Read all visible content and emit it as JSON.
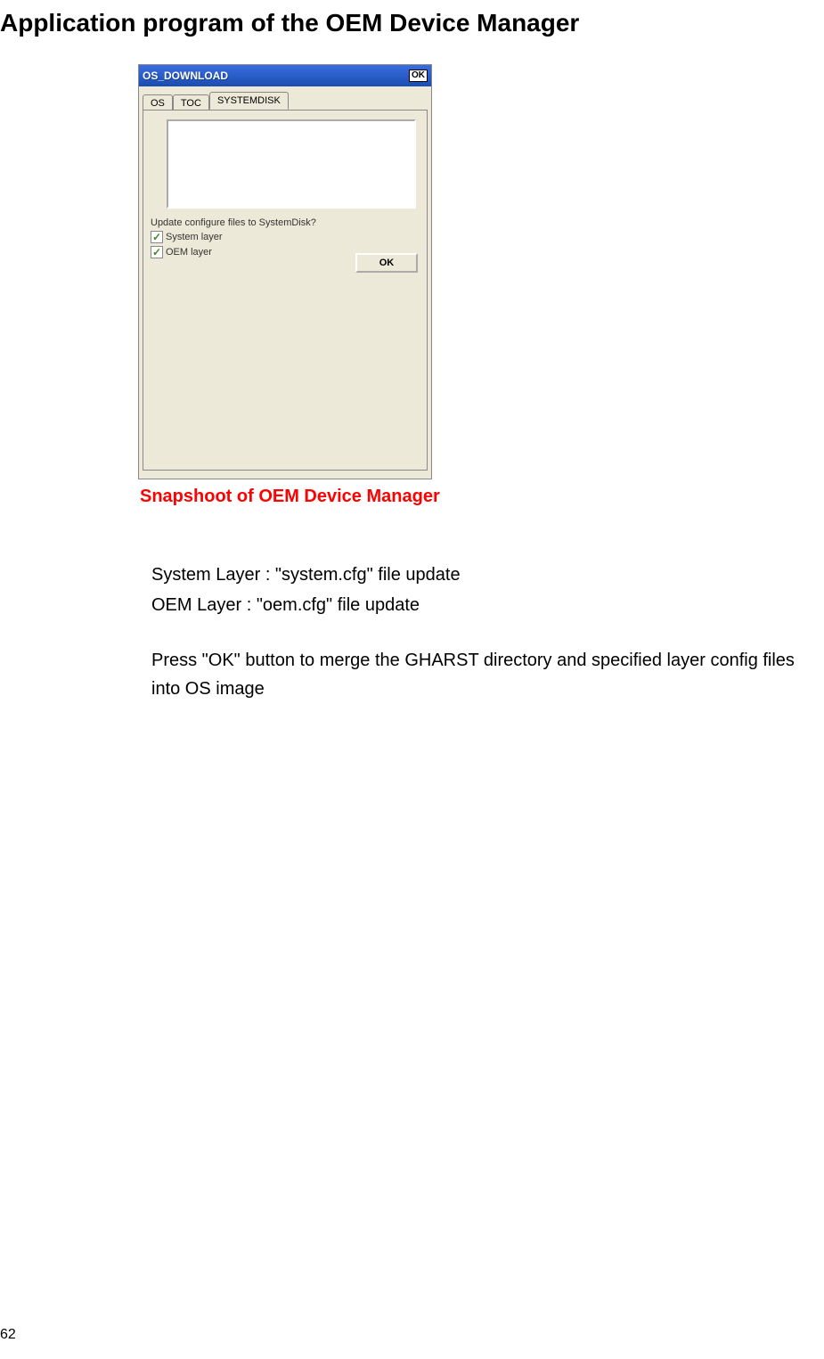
{
  "doc": {
    "title": "Application program of the OEM Device Manager",
    "caption": "Snapshoot of OEM Device Manager",
    "page_number": "62"
  },
  "screenshot": {
    "window_title": "OS_DOWNLOAD",
    "window_ok": "OK",
    "tabs": {
      "os": "OS",
      "toc": "TOC",
      "systemdisk": "SYSTEMDISK"
    },
    "question": "Update configure files to SystemDisk?",
    "checkbox1_label": "System layer",
    "checkbox2_label": "OEM layer",
    "ok_button": "OK"
  },
  "description": {
    "line1": "System Layer      : \"system.cfg\" file update",
    "line2": "OEM Layer    : \"oem.cfg\" file update",
    "para": "Press \"OK\" button to merge the GHARST directory and specified layer config files into OS image"
  }
}
